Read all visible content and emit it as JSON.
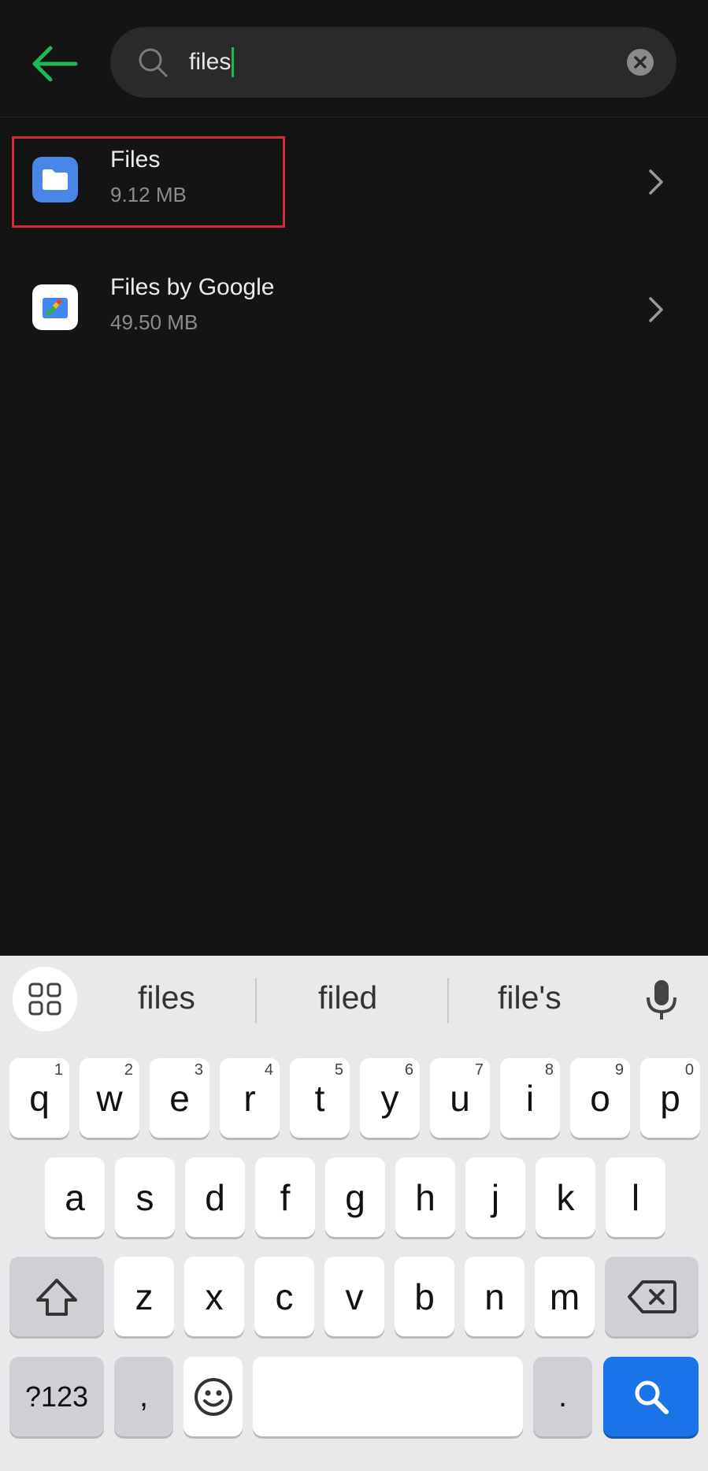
{
  "search": {
    "value": "files"
  },
  "results": [
    {
      "title": "Files",
      "size": "9.12 MB",
      "highlighted": true
    },
    {
      "title": "Files by Google",
      "size": "49.50 MB",
      "highlighted": false
    }
  ],
  "keyboard": {
    "suggestions": [
      "files",
      "filed",
      "file's"
    ],
    "row1": [
      {
        "k": "q",
        "n": "1"
      },
      {
        "k": "w",
        "n": "2"
      },
      {
        "k": "e",
        "n": "3"
      },
      {
        "k": "r",
        "n": "4"
      },
      {
        "k": "t",
        "n": "5"
      },
      {
        "k": "y",
        "n": "6"
      },
      {
        "k": "u",
        "n": "7"
      },
      {
        "k": "i",
        "n": "8"
      },
      {
        "k": "o",
        "n": "9"
      },
      {
        "k": "p",
        "n": "0"
      }
    ],
    "row2": [
      "a",
      "s",
      "d",
      "f",
      "g",
      "h",
      "j",
      "k",
      "l"
    ],
    "row3": [
      "z",
      "x",
      "c",
      "v",
      "b",
      "n",
      "m"
    ],
    "symbols": "?123",
    "comma": ",",
    "period": "."
  },
  "colors": {
    "accent": "#1db954",
    "highlight": "#d42a3a",
    "search_key": "#1a73e8"
  }
}
